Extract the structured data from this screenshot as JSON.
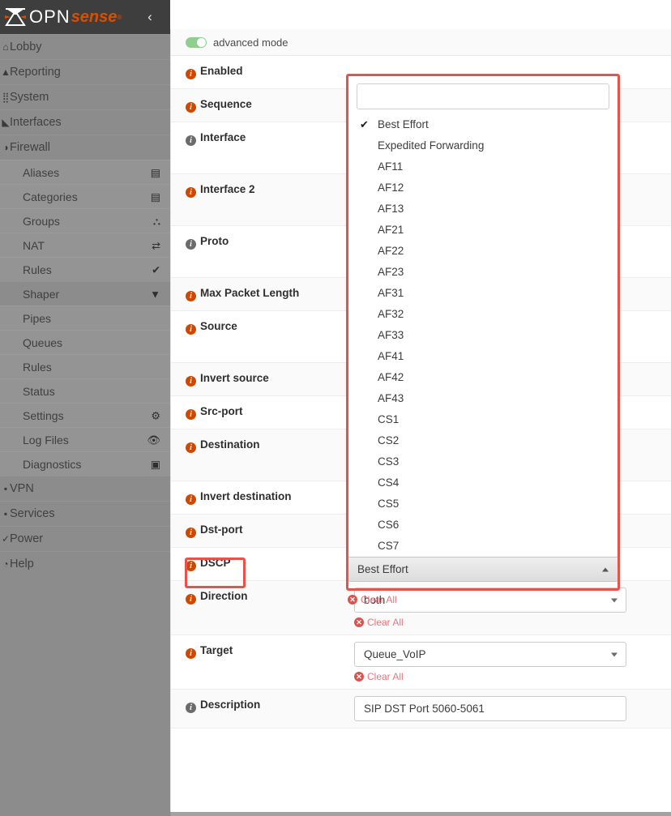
{
  "brand": {
    "name_opn": "OPN",
    "name_sense": "sense",
    "registered": "®",
    "collapse_icon": "‹"
  },
  "sidebar": {
    "items": [
      {
        "label": "Lobby",
        "icon": "home-icon",
        "right_icon": "",
        "sub": false
      },
      {
        "label": "Reporting",
        "icon": "chart-icon",
        "right_icon": "",
        "sub": false
      },
      {
        "label": "System",
        "icon": "sliders-icon",
        "right_icon": "",
        "sub": false
      },
      {
        "label": "Interfaces",
        "icon": "plug-icon",
        "right_icon": "",
        "sub": false
      },
      {
        "label": "Firewall",
        "icon": "shield-icon",
        "right_icon": "",
        "sub": false
      },
      {
        "label": "Aliases",
        "icon": "",
        "right_icon": "list-icon",
        "sub": true
      },
      {
        "label": "Categories",
        "icon": "",
        "right_icon": "list-icon",
        "sub": true
      },
      {
        "label": "Groups",
        "icon": "",
        "right_icon": "sitemap-icon",
        "sub": true
      },
      {
        "label": "NAT",
        "icon": "",
        "right_icon": "exchange-icon",
        "sub": true
      },
      {
        "label": "Rules",
        "icon": "",
        "right_icon": "check-icon",
        "sub": true
      },
      {
        "label": "Shaper",
        "icon": "",
        "right_icon": "filter-icon",
        "sub": true
      },
      {
        "label": "Pipes",
        "icon": "",
        "right_icon": "",
        "sub": true,
        "level2": true
      },
      {
        "label": "Queues",
        "icon": "",
        "right_icon": "",
        "sub": true,
        "level2": true
      },
      {
        "label": "Rules",
        "icon": "",
        "right_icon": "",
        "sub": true,
        "level2": true
      },
      {
        "label": "Status",
        "icon": "",
        "right_icon": "",
        "sub": true,
        "level2": true
      },
      {
        "label": "Settings",
        "icon": "",
        "right_icon": "gears-icon",
        "sub": true
      },
      {
        "label": "Log Files",
        "icon": "",
        "right_icon": "eye-icon",
        "sub": true
      },
      {
        "label": "Diagnostics",
        "icon": "",
        "right_icon": "medkit-icon",
        "sub": true
      },
      {
        "label": "VPN",
        "icon": "lock-icon",
        "right_icon": "",
        "sub": false
      },
      {
        "label": "Services",
        "icon": "cubes-icon",
        "right_icon": "",
        "sub": false
      },
      {
        "label": "Power",
        "icon": "power-icon",
        "right_icon": "",
        "sub": false
      },
      {
        "label": "Help",
        "icon": "question-icon",
        "right_icon": "",
        "sub": false
      }
    ]
  },
  "main": {
    "advanced_mode_label": "advanced mode",
    "advanced_mode_on": true,
    "rows": [
      {
        "label": "Enabled",
        "required": true,
        "tall": false
      },
      {
        "label": "Sequence",
        "required": true,
        "tall": false
      },
      {
        "label": "Interface",
        "required": false,
        "tall": true
      },
      {
        "label": "Interface 2",
        "required": true,
        "tall": true
      },
      {
        "label": "Proto",
        "required": false,
        "tall": true
      },
      {
        "label": "Max Packet Length",
        "required": true,
        "tall": false
      },
      {
        "label": "Source",
        "required": true,
        "tall": true
      },
      {
        "label": "Invert source",
        "required": true,
        "tall": false
      },
      {
        "label": "Src-port",
        "required": true,
        "tall": false
      },
      {
        "label": "Destination",
        "required": true,
        "tall": true
      },
      {
        "label": "Invert destination",
        "required": true,
        "tall": false
      },
      {
        "label": "Dst-port",
        "required": true,
        "tall": false
      },
      {
        "label": "DSCP",
        "required": true,
        "tall": false
      }
    ],
    "direction": {
      "label": "Direction",
      "value": "both",
      "clear_all": "Clear All"
    },
    "target": {
      "label": "Target",
      "value": "Queue_VoIP",
      "clear_all": "Clear All"
    },
    "description": {
      "label": "Description",
      "value": "SIP DST Port 5060-5061"
    }
  },
  "dscp_dropdown": {
    "label": "DSCP",
    "search_value": "",
    "selected": "Best Effort",
    "clear_all": "Clear All",
    "checkmark": "✔",
    "options": [
      "Best Effort",
      "Expedited Forwarding",
      "AF11",
      "AF12",
      "AF13",
      "AF21",
      "AF22",
      "AF23",
      "AF31",
      "AF32",
      "AF33",
      "AF41",
      "AF42",
      "AF43",
      "CS1",
      "CS2",
      "CS3",
      "CS4",
      "CS5",
      "CS6",
      "CS7"
    ]
  },
  "colors": {
    "brand_orange": "#d94f00",
    "required_icon": "#d04800",
    "highlight_red": "#e8524a",
    "toggle_green": "#8fce8f",
    "sidebar_gray": "#8c8c8c",
    "clear_red": "#d9534f"
  }
}
